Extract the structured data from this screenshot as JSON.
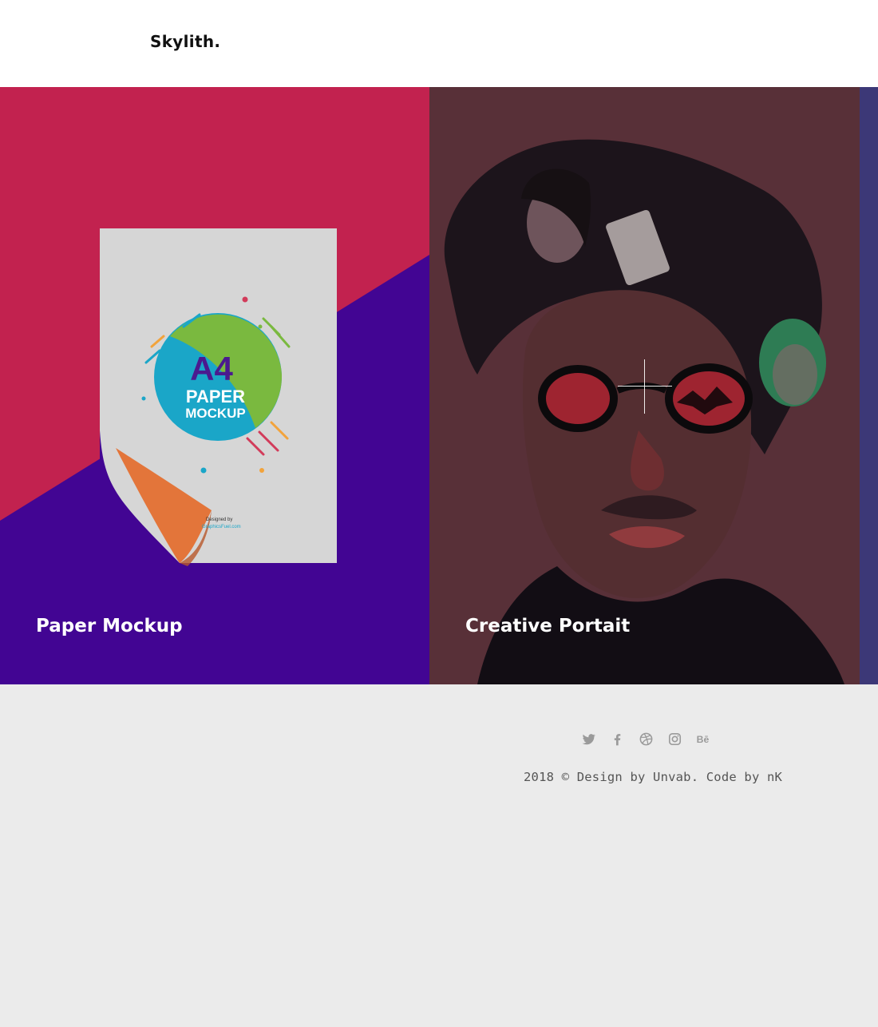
{
  "header": {
    "logo": "Skylith."
  },
  "slides": [
    {
      "title": "Paper Mockup",
      "mockup_text": {
        "big": "A4",
        "line1": "PAPER",
        "line2": "MOCKUP",
        "credit1": "Designed by",
        "credit2": "GraphicsFuel.com"
      }
    },
    {
      "title": "Creative Portait"
    }
  ],
  "footer": {
    "social": [
      "twitter-icon",
      "facebook-icon",
      "dribbble-icon",
      "instagram-icon",
      "behance-icon"
    ],
    "copyright": "2018 © Design by Unvab. Code by nK"
  },
  "colors": {
    "slide1_top": "#c2224f",
    "slide1_bottom": "#420593",
    "slide2_tint": "#6e3c46",
    "slide3": "#3c3877"
  }
}
